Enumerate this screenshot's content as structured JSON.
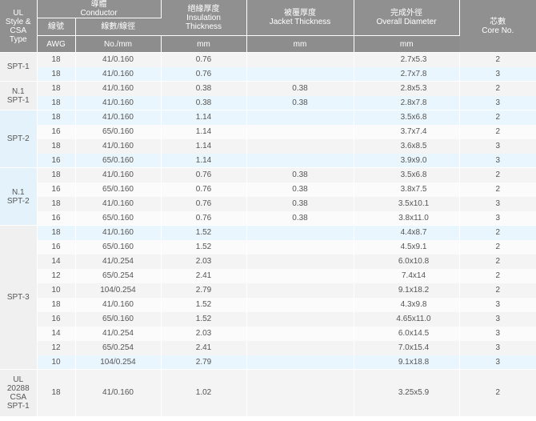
{
  "header": {
    "type": [
      "UL",
      "Style &",
      "CSA",
      "Type"
    ],
    "conductor": [
      "導體",
      "Conductor"
    ],
    "awg_zh": "線號",
    "strands_zh": "線數/線徑",
    "awg": "AWG",
    "strands_unit": "No./mm",
    "insulation": [
      "絕緣厚度",
      "Insulation",
      "Thickness"
    ],
    "insulation_unit": "mm",
    "jacket": [
      "被覆厚度",
      "Jacket Thickness"
    ],
    "jacket_unit": "mm",
    "overall": [
      "完成外徑",
      "Overall Diameter"
    ],
    "overall_unit": "mm",
    "core": [
      "芯數",
      "Core No."
    ]
  },
  "rows": [
    {
      "group": [
        "SPT-1"
      ],
      "awg": "18",
      "strands": "41/0.160",
      "ins": "0.76",
      "jacket": "",
      "od": "2.7x5.3",
      "core": "2"
    },
    {
      "awg": "18",
      "strands": "41/0.160",
      "ins": "0.76",
      "jacket": "",
      "od": "2.7x7.8",
      "core": "3"
    },
    {
      "group": [
        "N.1",
        "SPT-1"
      ],
      "awg": "18",
      "strands": "41/0.160",
      "ins": "0.38",
      "jacket": "0.38",
      "od": "2.8x5.3",
      "core": "2"
    },
    {
      "awg": "18",
      "strands": "41/0.160",
      "ins": "0.38",
      "jacket": "0.38",
      "od": "2.8x7.8",
      "core": "3"
    },
    {
      "group": [
        "SPT-2"
      ],
      "awg": "18",
      "strands": "41/0.160",
      "ins": "1.14",
      "jacket": "",
      "od": "3.5x6.8",
      "core": "2"
    },
    {
      "awg": "16",
      "strands": "65/0.160",
      "ins": "1.14",
      "jacket": "",
      "od": "3.7x7.4",
      "core": "2"
    },
    {
      "awg": "18",
      "strands": "41/0.160",
      "ins": "1.14",
      "jacket": "",
      "od": "3.6x8.5",
      "core": "3"
    },
    {
      "awg": "16",
      "strands": "65/0.160",
      "ins": "1.14",
      "jacket": "",
      "od": "3.9x9.0",
      "core": "3"
    },
    {
      "group": [
        "N.1",
        "SPT-2"
      ],
      "awg": "18",
      "strands": "41/0.160",
      "ins": "0.76",
      "jacket": "0.38",
      "od": "3.5x6.8",
      "core": "2"
    },
    {
      "awg": "16",
      "strands": "65/0.160",
      "ins": "0.76",
      "jacket": "0.38",
      "od": "3.8x7.5",
      "core": "2"
    },
    {
      "awg": "18",
      "strands": "41/0.160",
      "ins": "0.76",
      "jacket": "0.38",
      "od": "3.5x10.1",
      "core": "3"
    },
    {
      "awg": "16",
      "strands": "65/0.160",
      "ins": "0.76",
      "jacket": "0.38",
      "od": "3.8x11.0",
      "core": "3"
    },
    {
      "group": [
        "SPT-3"
      ],
      "awg": "18",
      "strands": "41/0.160",
      "ins": "1.52",
      "jacket": "",
      "od": "4.4x8.7",
      "core": "2"
    },
    {
      "awg": "16",
      "strands": "65/0.160",
      "ins": "1.52",
      "jacket": "",
      "od": "4.5x9.1",
      "core": "2"
    },
    {
      "awg": "14",
      "strands": "41/0.254",
      "ins": "2.03",
      "jacket": "",
      "od": "6.0x10.8",
      "core": "2"
    },
    {
      "awg": "12",
      "strands": "65/0.254",
      "ins": "2.41",
      "jacket": "",
      "od": "7.4x14",
      "core": "2"
    },
    {
      "awg": "10",
      "strands": "104/0.254",
      "ins": "2.79",
      "jacket": "",
      "od": "9.1x18.2",
      "core": "2"
    },
    {
      "awg": "18",
      "strands": "41/0.160",
      "ins": "1.52",
      "jacket": "",
      "od": "4.3x9.8",
      "core": "3"
    },
    {
      "awg": "16",
      "strands": "65/0.160",
      "ins": "1.52",
      "jacket": "",
      "od": "4.65x11.0",
      "core": "3"
    },
    {
      "awg": "14",
      "strands": "41/0.254",
      "ins": "2.03",
      "jacket": "",
      "od": "6.0x14.5",
      "core": "3"
    },
    {
      "awg": "12",
      "strands": "65/0.254",
      "ins": "2.41",
      "jacket": "",
      "od": "7.0x15.4",
      "core": "3"
    },
    {
      "awg": "10",
      "strands": "104/0.254",
      "ins": "2.79",
      "jacket": "",
      "od": "9.1x18.8",
      "core": "3"
    },
    {
      "group": [
        "UL",
        "20288",
        "CSA",
        "SPT-1"
      ],
      "awg": "18",
      "strands": "41/0.160",
      "ins": "1.02",
      "jacket": "",
      "od": "3.25x5.9",
      "core": "2"
    }
  ],
  "groups": [
    {
      "start": 0,
      "span": 2
    },
    {
      "start": 2,
      "span": 2
    },
    {
      "start": 4,
      "span": 4
    },
    {
      "start": 8,
      "span": 4
    },
    {
      "start": 12,
      "span": 10
    },
    {
      "start": 22,
      "span": 1
    }
  ],
  "highlight_rows": [
    1,
    3,
    4,
    7,
    12,
    21
  ]
}
